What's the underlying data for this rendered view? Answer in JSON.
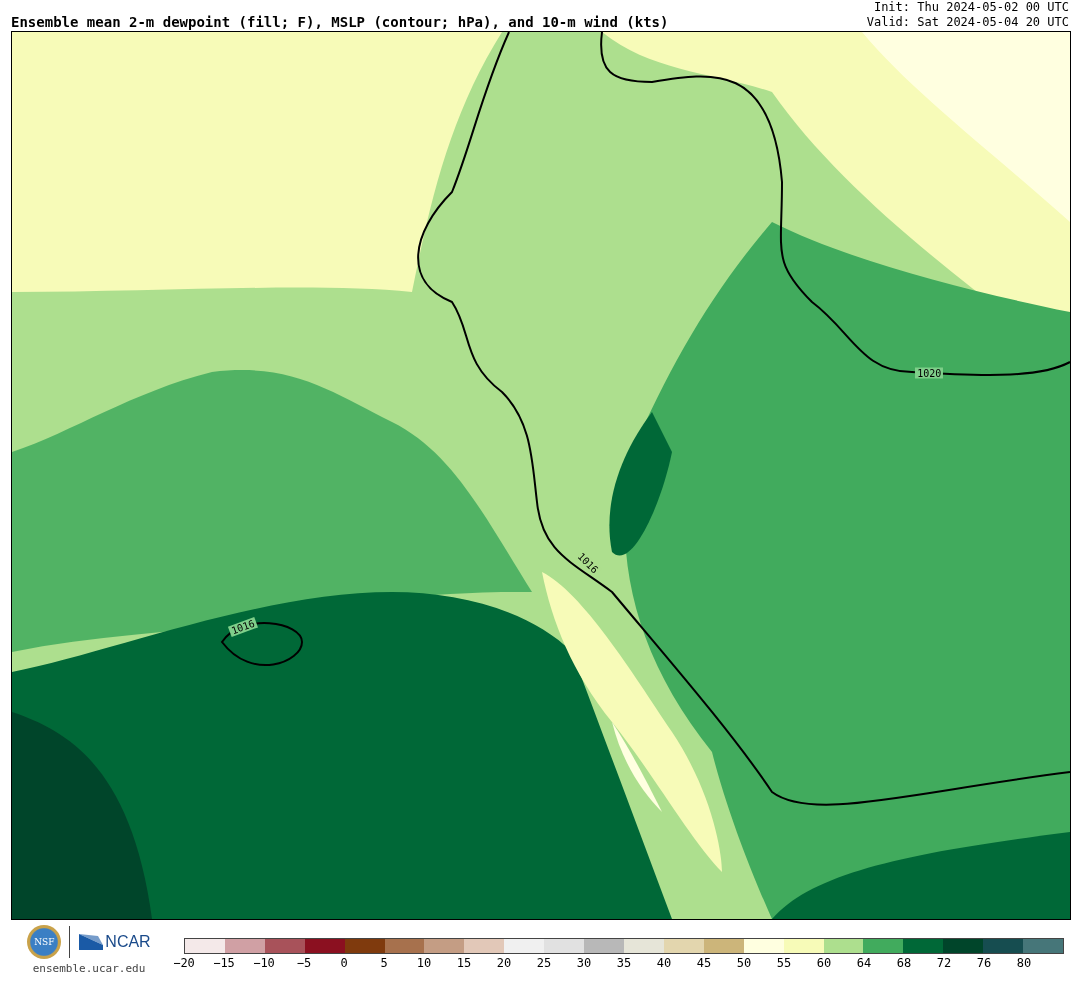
{
  "title": "Ensemble mean 2-m dewpoint (fill; F), MSLP (contour; hPa), and 10-m wind (kts)",
  "init": "Init: Thu 2024-05-02 00 UTC",
  "valid": "Valid: Sat 2024-05-04 20 UTC",
  "map": {
    "contour_labels": [
      {
        "text": "1020"
      },
      {
        "text": "1016"
      },
      {
        "text": "1016"
      }
    ]
  },
  "logos": {
    "nsf": "NSF",
    "ncar": "NCAR",
    "url": "ensemble.ucar.edu"
  },
  "colorbar": {
    "swatches": [
      {
        "label": "−20",
        "color": "#f4e9e9"
      },
      {
        "label": "−15",
        "color": "#d0a0a4"
      },
      {
        "label": "−10",
        "color": "#a8525a"
      },
      {
        "label": "−5",
        "color": "#8b1020"
      },
      {
        "label": "0",
        "color": "#7f3a0d"
      },
      {
        "label": "5",
        "color": "#a7714d"
      },
      {
        "label": "10",
        "color": "#c49d84"
      },
      {
        "label": "15",
        "color": "#e2c8b8"
      },
      {
        "label": "20",
        "color": "#f0f0f0"
      },
      {
        "label": "25",
        "color": "#e1e1e1"
      },
      {
        "label": "30",
        "color": "#b8b8b8"
      },
      {
        "label": "35",
        "color": "#e6e5d8"
      },
      {
        "label": "40",
        "color": "#e3d6ae"
      },
      {
        "label": "45",
        "color": "#ccb57a"
      },
      {
        "label": "50",
        "color": "#ffffe0"
      },
      {
        "label": "55",
        "color": "#f7fbb8"
      },
      {
        "label": "60",
        "color": "#addf8e"
      },
      {
        "label": "64",
        "color": "#41ab5d"
      },
      {
        "label": "68",
        "color": "#006837"
      },
      {
        "label": "72",
        "color": "#00452a"
      },
      {
        "label": "76",
        "color": "#164d50"
      },
      {
        "label": "80",
        "color": "#467679"
      }
    ]
  }
}
